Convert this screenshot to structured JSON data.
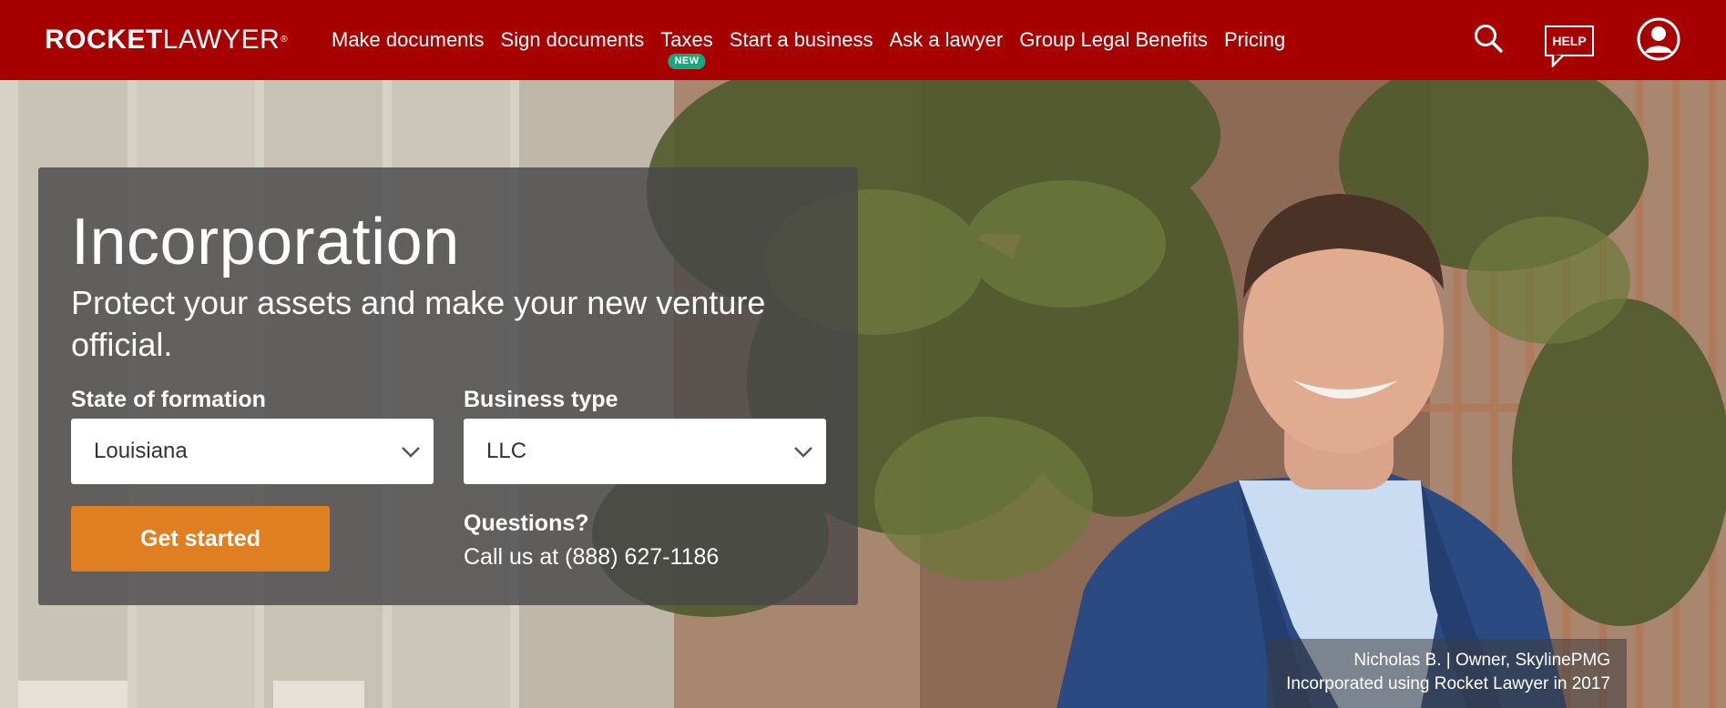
{
  "brand": {
    "logo_bold": "ROCKET",
    "logo_light": "LAWYER",
    "logo_mark": "®",
    "colors": {
      "header": "#a60000",
      "accent": "#e07f22",
      "badge": "#17a77f"
    }
  },
  "nav": {
    "items": [
      {
        "label": "Make documents"
      },
      {
        "label": "Sign documents"
      },
      {
        "label": "Taxes",
        "badge": "NEW"
      },
      {
        "label": "Start a business"
      },
      {
        "label": "Ask a lawyer"
      },
      {
        "label": "Group Legal Benefits"
      },
      {
        "label": "Pricing"
      }
    ],
    "search_icon": "search-icon",
    "help_label": "HELP",
    "account_icon": "user-account-icon"
  },
  "hero": {
    "title": "Incorporation",
    "subtitle": "Protect your assets and make your new venture official.",
    "state_label": "State of formation",
    "state_value": "Louisiana",
    "type_label": "Business type",
    "type_value": "LLC",
    "cta_label": "Get started",
    "questions_label": "Questions?",
    "phone_prefix": "Call us at ",
    "phone_number": "(888) 627-1186"
  },
  "caption": {
    "line1": "Nicholas B. | Owner, SkylinePMG",
    "line2": "Incorporated using Rocket Lawyer in 2017"
  }
}
